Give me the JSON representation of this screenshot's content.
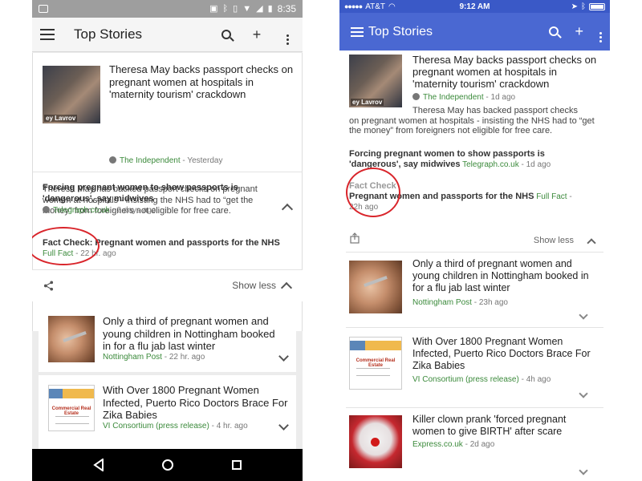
{
  "android": {
    "status": {
      "time": "8:35"
    },
    "toolbar": {
      "title": "Top Stories"
    },
    "lead": {
      "title": "Theresa May backs passport checks on pregnant women at hospitals in 'maternity tourism' crackdown",
      "image_caption": "ey Lavrov",
      "source": "The Independent",
      "time": " - Yesterday",
      "snippet": "Theresa May has backed passport checks on pregnant women at hospitals - insisting the NHS had to “get the money” from foreigners not eligible for free care."
    },
    "related": [
      {
        "title": "Forcing pregnant women to show passports is 'dangerous', say midwives",
        "source": "Telegraph.co.uk",
        "time": " - 2 days ago"
      },
      {
        "title": "Fact Check: Pregnant women and passports for the NHS",
        "source": "Full Fact",
        "time": " - 22 hr. ago"
      }
    ],
    "show_less": "Show less",
    "cards": [
      {
        "title": "Only a third of pregnant women and young children in Nottingham booked in for a flu jab last winter",
        "source": "Nottingham Post",
        "time": " - 22 hr. ago"
      },
      {
        "title": "With Over 1800 Pregnant Women Infected, Puerto Rico Doctors Brace For Zika Babies",
        "source": "VI Consortium (press release)",
        "time": " - 4 hr. ago",
        "flyer_text": "Commercial Real Estate"
      }
    ]
  },
  "ios": {
    "status": {
      "carrier": "AT&T",
      "time": "9:12 AM"
    },
    "toolbar": {
      "title": "Top Stories"
    },
    "lead": {
      "title": "Theresa May backs passport checks on pregnant women at hospitals in 'maternity tourism' crackdown",
      "image_caption": "ey Lavrov",
      "source": "The Independent",
      "time": " - 1d ago",
      "snippet_line1": "Theresa May has backed passport checks",
      "snippet_rest": "on pregnant women at hospitals - insisting the NHS had to “get the money” from foreigners not eligible for free care."
    },
    "related": [
      {
        "title": "Forcing pregnant women to show passports is 'dangerous', say midwives",
        "source": "Telegraph.co.uk",
        "time": " - 1d ago"
      },
      {
        "label": "Fact Check",
        "title": "Pregnant women and passports for the NHS",
        "source": "Full Fact",
        "time": "22h ago"
      }
    ],
    "show_less": "Show less",
    "cards": [
      {
        "title": "Only a third of pregnant women and young children in Nottingham booked in for a flu jab last winter",
        "source": "Nottingham Post",
        "time": " - 23h ago"
      },
      {
        "title": "With Over 1800 Pregnant Women Infected, Puerto Rico Doctors Brace For Zika Babies",
        "source": "VI Consortium (press release)",
        "time": " - 4h ago",
        "flyer_text": "Commercial Real Estate"
      },
      {
        "title": "Killer clown prank 'forced pregnant women to give BIRTH' after scare",
        "source": "Express.co.uk",
        "time": " - 2d ago"
      }
    ]
  },
  "colors": {
    "android_status": "#9e9e9e",
    "ios_toolbar": "#4a68d2",
    "source_green": "#3b8a3b",
    "annotation_red": "#d9252b"
  }
}
